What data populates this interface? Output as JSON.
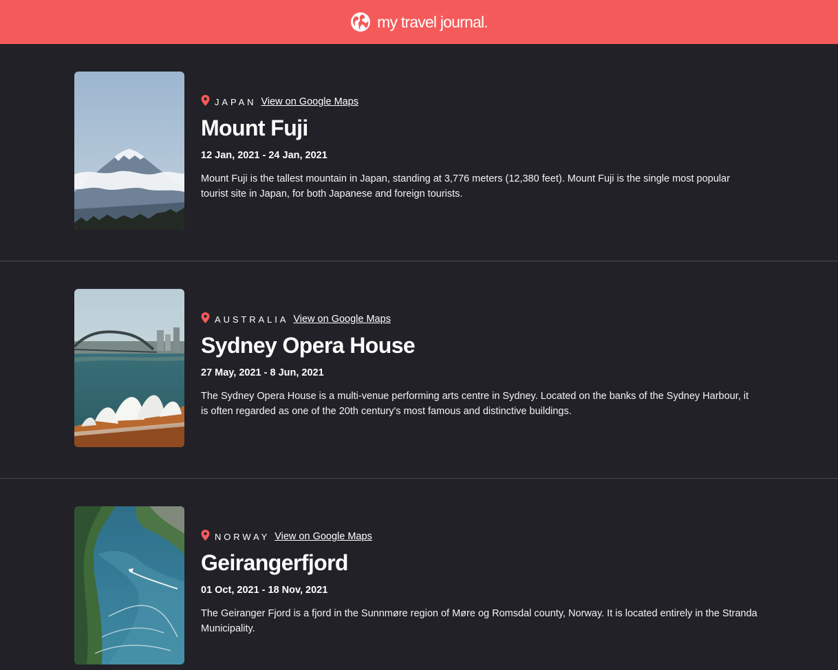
{
  "header": {
    "brand": "my travel journal.",
    "logo_icon": "globe-icon",
    "background": "#F55A5A"
  },
  "entries": [
    {
      "country": "JAPAN",
      "maps_link": "View on Google Maps",
      "title": "Mount Fuji",
      "dates": "12 Jan, 2021 - 24 Jan, 2021",
      "description": "Mount Fuji is the tallest mountain in Japan, standing at 3,776 meters (12,380 feet). Mount Fuji is the single most popular tourist site in Japan, for both Japanese and foreign tourists.",
      "photo": "mount-fuji-photo"
    },
    {
      "country": "AUSTRALIA",
      "maps_link": "View on Google Maps",
      "title": "Sydney Opera House",
      "dates": "27 May, 2021 - 8 Jun, 2021",
      "description": "The Sydney Opera House is a multi-venue performing arts centre in Sydney. Located on the banks of the Sydney Harbour, it is often regarded as one of the 20th century's most famous and distinctive buildings.",
      "photo": "sydney-opera-house-photo"
    },
    {
      "country": "NORWAY",
      "maps_link": "View on Google Maps",
      "title": "Geirangerfjord",
      "dates": "01 Oct, 2021 - 18 Nov, 2021",
      "description": "The Geiranger Fjord is a fjord in the Sunnmøre region of Møre og Romsdal county, Norway. It is located entirely in the Stranda Municipality.",
      "photo": "geirangerfjord-photo"
    }
  ],
  "colors": {
    "accent": "#F55A5A",
    "page_background": "#222127",
    "divider": "#4a4950"
  }
}
